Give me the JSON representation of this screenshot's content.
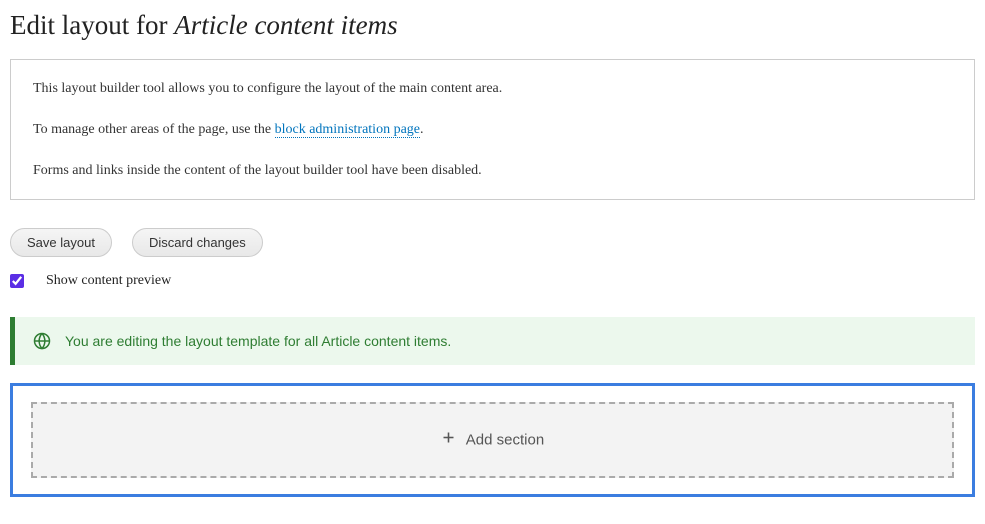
{
  "title": {
    "prefix": "Edit layout for ",
    "italic": "Article content items"
  },
  "info": {
    "line1": "This layout builder tool allows you to configure the layout of the main content area.",
    "line2_prefix": "To manage other areas of the page, use the ",
    "line2_link": "block administration page",
    "line2_suffix": ".",
    "line3": "Forms and links inside the content of the layout builder tool have been disabled."
  },
  "buttons": {
    "save": "Save layout",
    "discard": "Discard changes"
  },
  "checkbox": {
    "label": "Show content preview",
    "checked": true
  },
  "status": {
    "message": "You are editing the layout template for all Article content items."
  },
  "canvas": {
    "add_section": "Add section"
  }
}
